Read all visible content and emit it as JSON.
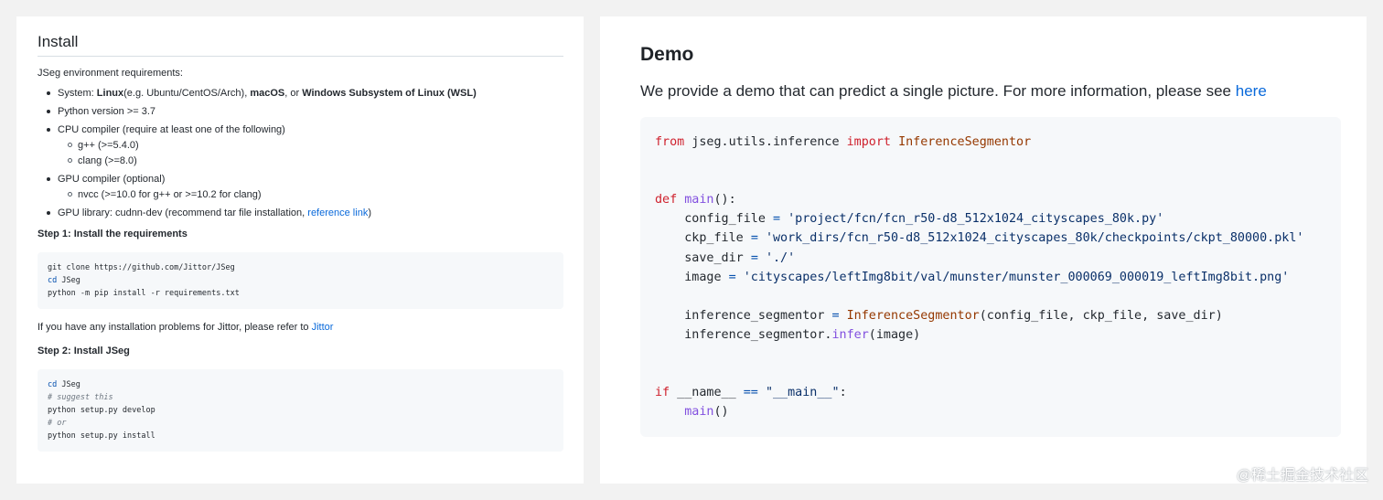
{
  "left": {
    "title": "Install",
    "env_intro": "JSeg environment requirements:",
    "req": {
      "system_prefix": "System: ",
      "linux": "Linux",
      "linux_examples": "(e.g. Ubuntu/CentOS/Arch), ",
      "macos": "macOS",
      "or_text": ", or ",
      "wsl": "Windows Subsystem of Linux (WSL)",
      "python": "Python version >= 3.7",
      "cpu": "CPU compiler (require at least one of the following)",
      "gpp": "g++ (>=5.4.0)",
      "clang": "clang (>=8.0)",
      "gpu": "GPU compiler (optional)",
      "nvcc": "nvcc (>=10.0 for g++ or >=10.2 for clang)",
      "gpulib_prefix": "GPU library: cudnn-dev (recommend tar file installation, ",
      "ref_link": "reference link",
      "gpulib_suffix": ")"
    },
    "step1": "Step 1: Install the requirements",
    "code1": {
      "line1": "git clone https://github.com/Jittor/JSeg",
      "line2_kw": "cd",
      "line2_rest": " JSeg",
      "line3": "python -m pip install -r requirements.txt"
    },
    "problems_text": "If you have any installation problems for Jittor, please refer to ",
    "jittor_link": "Jittor",
    "step2": "Step 2: Install JSeg",
    "code2": {
      "line1_kw": "cd",
      "line1_rest": " JSeg",
      "line2": "# suggest this",
      "line3": "python setup.py develop",
      "line4": "# or",
      "line5": "python setup.py install"
    }
  },
  "right": {
    "title": "Demo",
    "desc": "We provide a demo that can predict a single picture. For more information, please see ",
    "here_link": "here",
    "code": {
      "from": "from",
      "module": " jseg.utils.inference ",
      "import": "import",
      "cls": "InferenceSegmentor",
      "def": "def",
      "main": "main",
      "def_tail": "():",
      "config_var": "    config_file ",
      "config_val": "'project/fcn/fcn_r50-d8_512x1024_cityscapes_80k.py'",
      "ckp_var": "    ckp_file ",
      "ckp_val": "'work_dirs/fcn_r50-d8_512x1024_cityscapes_80k/checkpoints/ckpt_80000.pkl'",
      "save_var": "    save_dir ",
      "save_val": "'./'",
      "image_var": "    image ",
      "image_val": "'cityscapes/leftImg8bit/val/munster/munster_000069_000019_leftImg8bit.png'",
      "seg_var": "    inference_segmentor ",
      "seg_args": "(config_file, ckp_file, save_dir)",
      "call_obj": "    inference_segmentor.",
      "infer": "infer",
      "call_args": "(image)",
      "if": "if",
      "name_left": " __name__ ",
      "eqeq": "==",
      "main_str": "\"__main__\"",
      "colon": ":",
      "main_call_indent": "    ",
      "main_call_tail": "()",
      "eq": "="
    }
  },
  "watermark": "@稀土掘金技术社区"
}
